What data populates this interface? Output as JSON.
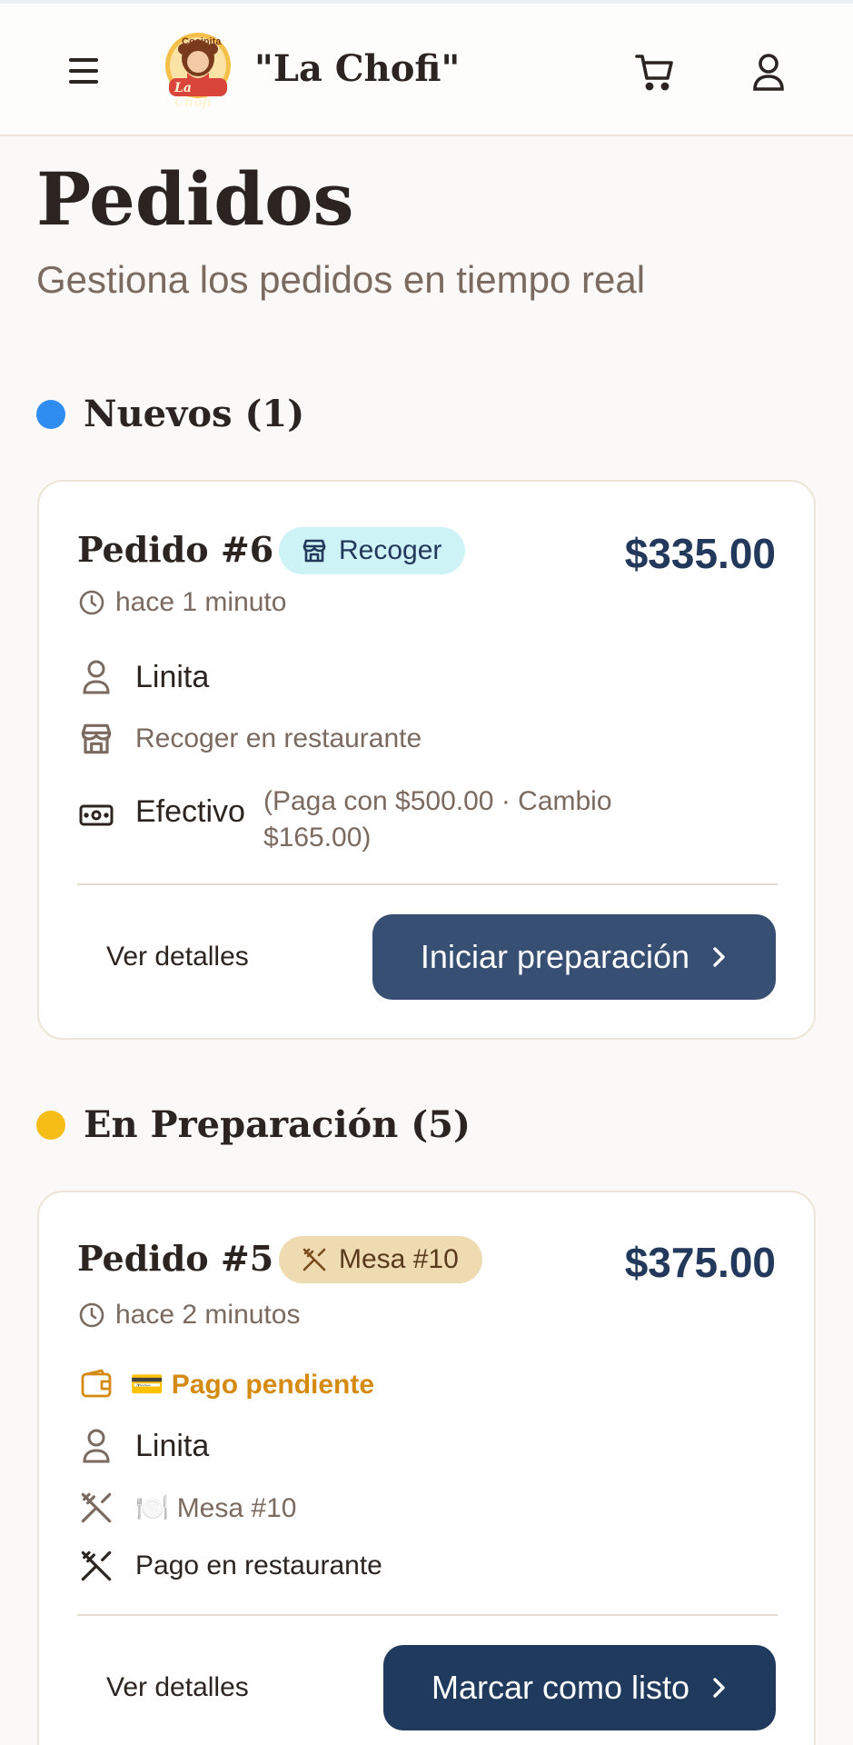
{
  "header": {
    "brand": "\"La Chofi\"",
    "logo_text_top": "Cocinita",
    "logo_text_main": "La Chofi",
    "icons": [
      "menu-icon",
      "cart-icon",
      "user-icon"
    ]
  },
  "page": {
    "title": "Pedidos",
    "subtitle": "Gestiona los pedidos en tiempo real"
  },
  "sections": {
    "new": {
      "label": "Nuevos (1)",
      "color": "#2f8cf0"
    },
    "prep": {
      "label": "En Preparación (5)",
      "color": "#f6bd16"
    }
  },
  "orders": {
    "o6": {
      "title": "Pedido #6",
      "badge": "Recoger",
      "price": "$335.00",
      "time": "hace 1 minuto",
      "customer": "Linita",
      "delivery": "Recoger en restaurante",
      "payment_method": "Efectivo",
      "payment_note_1": "(Paga con $500.00 · Cambio",
      "payment_note_2": "$165.00)",
      "details_label": "Ver detalles",
      "action_label": "Iniciar preparación"
    },
    "o5": {
      "title": "Pedido #5",
      "badge": "Mesa #10",
      "price": "$375.00",
      "time": "hace 2 minutos",
      "payment_status": "💳 Pago pendiente",
      "customer": "Linita",
      "table": "🍽️ Mesa #10",
      "payment_method": "Pago en restaurante",
      "details_label": "Ver detalles",
      "action_label": "Marcar como listo"
    }
  },
  "colors": {
    "accent_navy": "#23395b",
    "badge_pickup_bg": "#cdf3f6",
    "badge_table_bg": "#eedbb1",
    "pending": "#d58a12"
  }
}
